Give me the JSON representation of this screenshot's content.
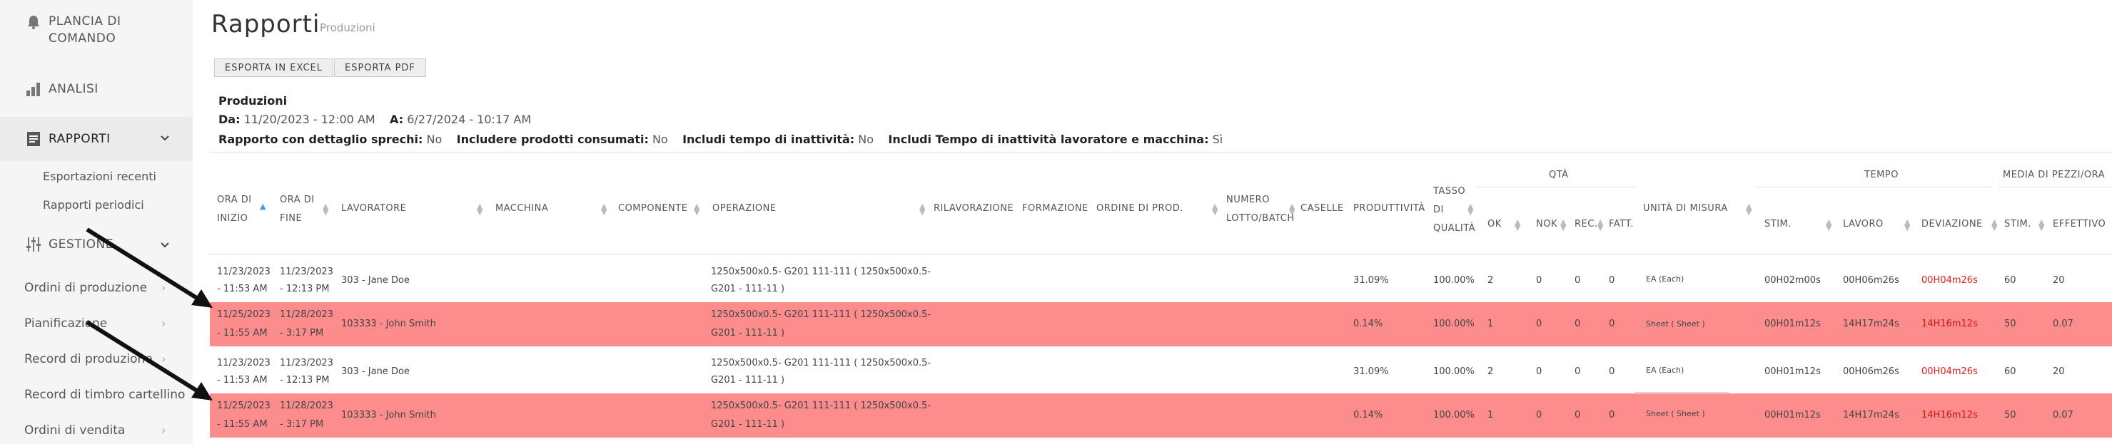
{
  "sidebar": {
    "items": [
      {
        "label": "PLANCIA DI COMANDO",
        "icon": "bell-icon"
      },
      {
        "label": "ANALISI",
        "icon": "bar-chart-icon"
      },
      {
        "label": "RAPPORTI",
        "icon": "report-icon"
      },
      {
        "label": "GESTIONE",
        "icon": "sliders-icon"
      }
    ],
    "rapporti_sub": [
      "Esportazioni recenti",
      "Rapporti periodici"
    ],
    "gestione_sub": [
      "Ordini di produzione",
      "Pianificazione",
      "Record di produzione",
      "Record di timbro cartellino",
      "Ordini di vendita"
    ]
  },
  "header": {
    "title": "Rapporti",
    "subtitle": "Produzioni"
  },
  "toolbar": {
    "excel": "ESPORTA IN EXCEL",
    "pdf": "ESPORTA PDF"
  },
  "info": {
    "heading": "Produzioni",
    "da_label": "Da:",
    "da_value": "11/20/2023 - 12:00 AM",
    "a_label": "A:",
    "a_value": "6/27/2024 - 10:17 AM",
    "f1_label": "Rapporto con dettaglio sprechi:",
    "f1_value": "No",
    "f2_label": "Includere prodotti consumati:",
    "f2_value": "No",
    "f3_label": "Includi tempo di inattività:",
    "f3_value": "No",
    "f4_label": "Includi Tempo di inattività lavoratore e macchina:",
    "f4_value": "Sì"
  },
  "table": {
    "groups": {
      "qta": "QTÀ",
      "tempo": "TEMPO",
      "media": "MEDIA DI PEZZI/ORA"
    },
    "columns": {
      "ora_inizio": "ORA DI INIZIO",
      "ora_fine": "ORA DI FINE",
      "lavoratore": "LAVORATORE",
      "macchina": "MACCHINA",
      "componente": "COMPONENTE",
      "operazione": "OPERAZIONE",
      "rilavorazione": "RILAVORAZIONE",
      "formazione": "FORMAZIONE",
      "ordine": "ORDINE DI PROD.",
      "lotto": "NUMERO LOTTO/BATCH",
      "caselle": "CASELLE",
      "produttivita": "PRODUTTIVITÀ",
      "tasso": "TASSO DI QUALITÀ",
      "ok": "OK",
      "nok": "NOK",
      "rec": "REC.",
      "fatt": "FATT.",
      "unita": "UNITÀ DI MISURA",
      "stim": "STIM.",
      "lavoro": "LAVORO",
      "deviazione": "DEVIAZIONE",
      "m_stim": "STIM.",
      "effettivo": "EFFETTIVO"
    },
    "rows": [
      {
        "start1": "11/23/2023",
        "start2": "- 11:53 AM",
        "end1": "11/23/2023",
        "end2": "- 12:13 PM",
        "worker": "303 - Jane Doe",
        "op1": "1250x500x0.5- G201 111-111 ( 1250x500x0.5-",
        "op2": "G201 - 111-11 )",
        "prod": "31.09%",
        "tasso": "100.00%",
        "ok": "2",
        "nok": "0",
        "rec": "0",
        "fatt": "0",
        "unit": "EA (Each)",
        "stim": "00H02m00s",
        "lavoro": "00H06m26s",
        "dev": "00H04m26s",
        "mstim": "60",
        "eff": "20"
      },
      {
        "start1": "11/25/2023",
        "start2": "- 11:55 AM",
        "end1": "11/28/2023",
        "end2": "- 3:17 PM",
        "worker": "103333 - John Smith",
        "op1": "1250x500x0.5- G201 111-111 ( 1250x500x0.5-",
        "op2": "G201 - 111-11 )",
        "prod": "0.14%",
        "tasso": "100.00%",
        "ok": "1",
        "nok": "0",
        "rec": "0",
        "fatt": "0",
        "unit": "Sheet ( Sheet )",
        "stim": "00H01m12s",
        "lavoro": "14H17m24s",
        "dev": "14H16m12s",
        "mstim": "50",
        "eff": "0.07"
      },
      {
        "start1": "11/23/2023",
        "start2": "- 11:53 AM",
        "end1": "11/23/2023",
        "end2": "- 12:13 PM",
        "worker": "303 - Jane Doe",
        "op1": "1250x500x0.5- G201 111-111 ( 1250x500x0.5-",
        "op2": "G201 - 111-11 )",
        "prod": "31.09%",
        "tasso": "100.00%",
        "ok": "2",
        "nok": "0",
        "rec": "0",
        "fatt": "0",
        "unit": "EA (Each)",
        "stim": "00H01m12s",
        "lavoro": "00H06m26s",
        "dev": "00H04m26s",
        "mstim": "60",
        "eff": "20"
      },
      {
        "start1": "11/25/2023",
        "start2": "- 11:55 AM",
        "end1": "11/28/2023",
        "end2": "- 3:17 PM",
        "worker": "103333 - John Smith",
        "op1": "1250x500x0.5- G201 111-111 ( 1250x500x0.5-",
        "op2": "G201 - 111-11 )",
        "prod": "0.14%",
        "tasso": "100.00%",
        "ok": "1",
        "nok": "0",
        "rec": "0",
        "fatt": "0",
        "unit": "Sheet ( Sheet )",
        "stim": "00H01m12s",
        "lavoro": "14H17m24s",
        "dev": "14H16m12s",
        "mstim": "50",
        "eff": "0.07"
      }
    ]
  },
  "colors": {
    "highlight_row": "#fd8c8c",
    "deviation": "#e02020"
  }
}
